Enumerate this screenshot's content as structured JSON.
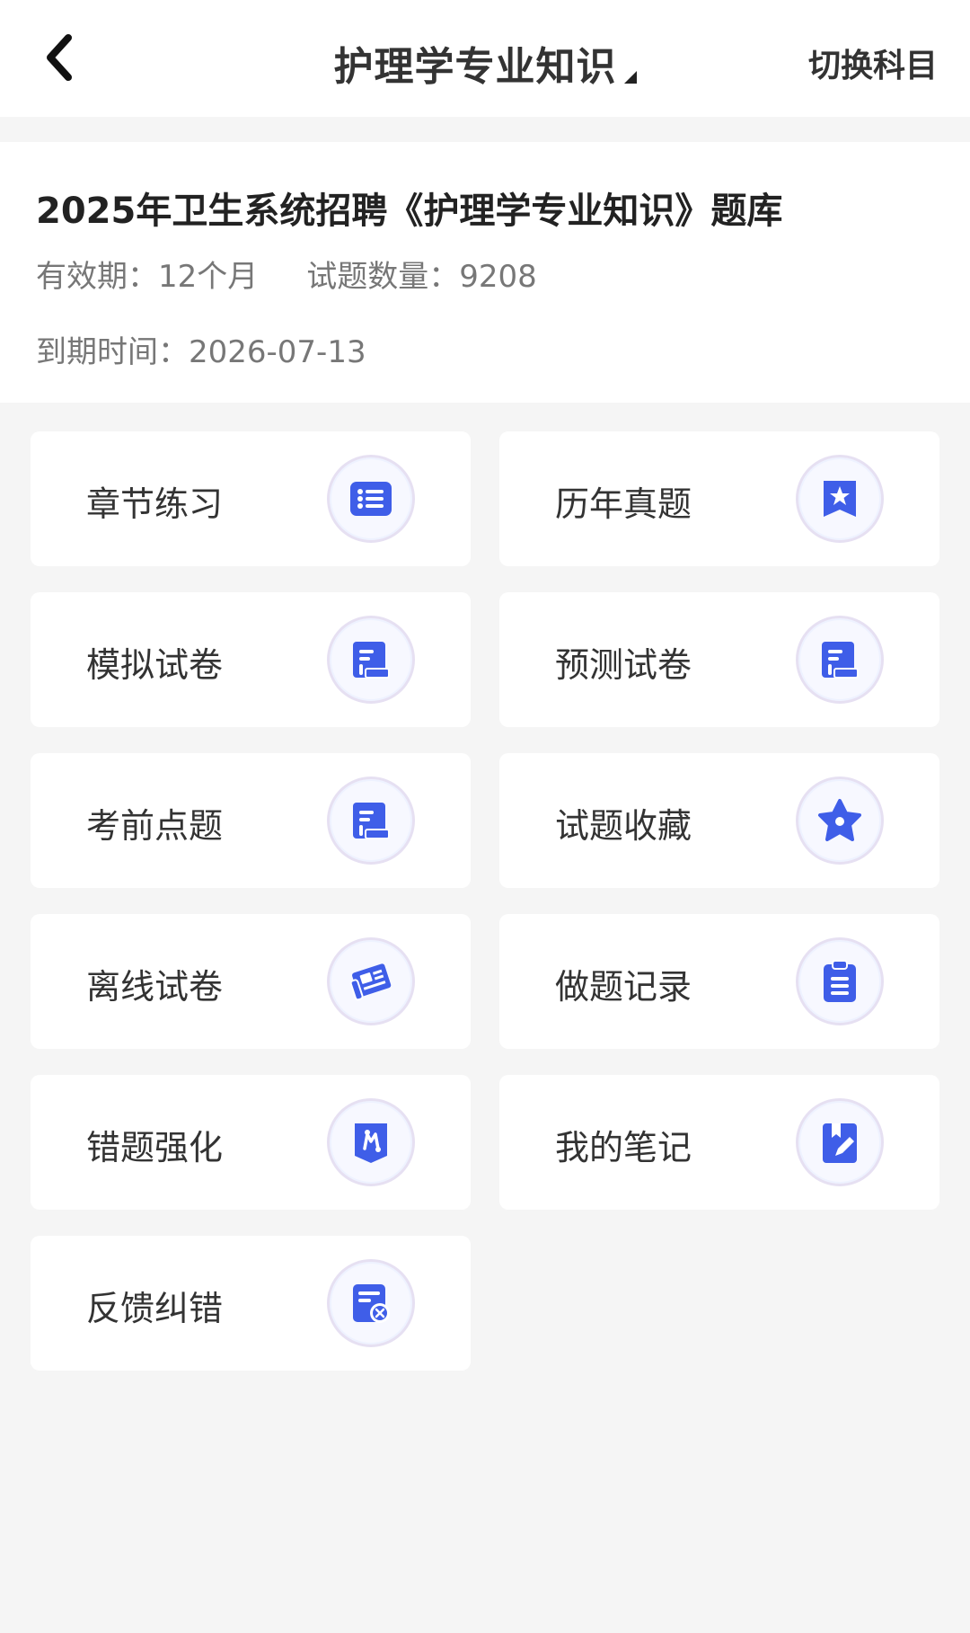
{
  "nav": {
    "title": "护理学专业知识",
    "switch_label": "切换科目"
  },
  "info": {
    "title": "2025年卫生系统招聘《护理学专业知识》题库",
    "validity": "有效期：12个月",
    "question_count": "试题数量：9208",
    "expiry": "到期时间：2026-07-13"
  },
  "colors": {
    "icon_primary": "#3f5ee8",
    "icon_ring": "#e6e0f2",
    "background": "#f5f5f5"
  },
  "menu": [
    {
      "label": "章节练习",
      "icon": "list-icon"
    },
    {
      "label": "历年真题",
      "icon": "star-bookmark-icon"
    },
    {
      "label": "模拟试卷",
      "icon": "paper-icon"
    },
    {
      "label": "预测试卷",
      "icon": "paper-icon"
    },
    {
      "label": "考前点题",
      "icon": "paper-icon"
    },
    {
      "label": "试题收藏",
      "icon": "star-icon"
    },
    {
      "label": "离线试卷",
      "icon": "newspaper-icon"
    },
    {
      "label": "做题记录",
      "icon": "clipboard-icon"
    },
    {
      "label": "错题强化",
      "icon": "mistake-icon"
    },
    {
      "label": "我的笔记",
      "icon": "note-pen-icon"
    },
    {
      "label": "反馈纠错",
      "icon": "feedback-icon"
    }
  ]
}
